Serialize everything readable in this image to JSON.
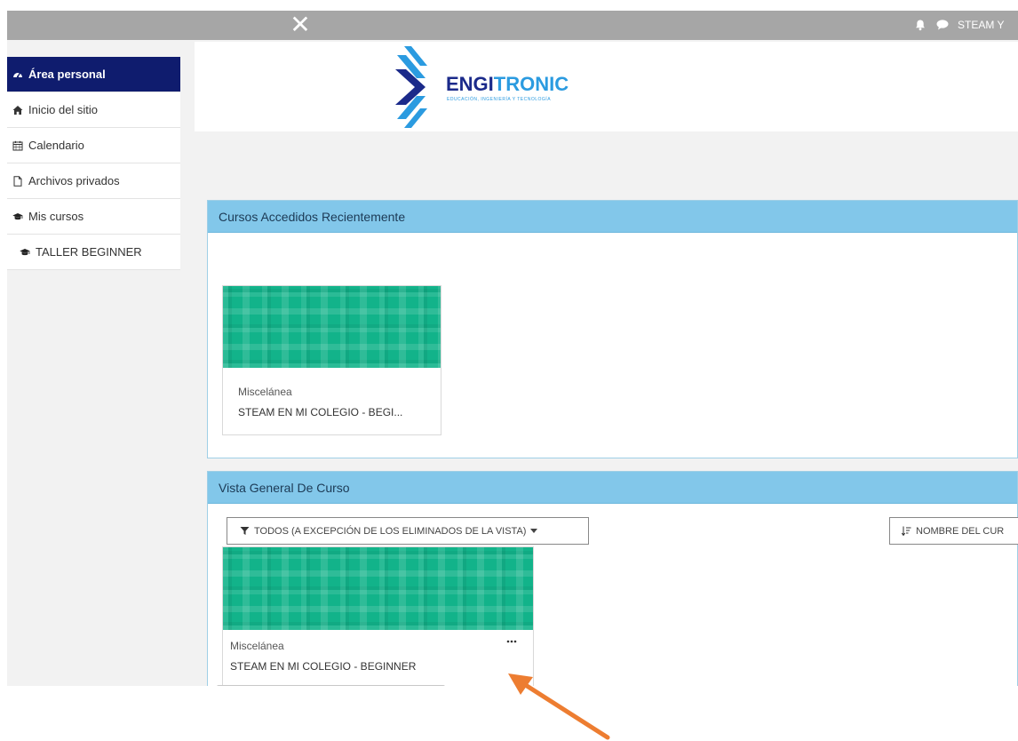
{
  "topbar": {
    "close_icon": "close-icon",
    "close_glyph": "✕",
    "user_name": "STEAM Y"
  },
  "sidebar": {
    "items": [
      {
        "label": "Área personal",
        "icon": "tachometer-icon",
        "active": true
      },
      {
        "label": "Inicio del sitio",
        "icon": "home-icon"
      },
      {
        "label": "Calendario",
        "icon": "calendar-icon"
      },
      {
        "label": "Archivos privados",
        "icon": "file-icon"
      },
      {
        "label": "Mis cursos",
        "icon": "graduation-cap-icon"
      },
      {
        "label": "TALLER BEGINNER",
        "icon": "graduation-cap-icon"
      }
    ]
  },
  "logo": {
    "name_part1": "ENGI",
    "name_part2": "TRONIC",
    "tagline": "EDUCACIÓN, INGENIERÍA Y TECNOLOGÍA",
    "colors": {
      "dark": "#1b2a8a",
      "light": "#2b9be0"
    }
  },
  "recent": {
    "title": "Cursos Accedidos Recientemente",
    "course": {
      "category": "Miscelánea",
      "name": "STEAM EN MI COLEGIO - BEGI..."
    }
  },
  "overview": {
    "title": "Vista General De Curso",
    "filter_label": "TODOS (A EXCEPCIÓN DE LOS ELIMINADOS DE LA VISTA)",
    "sort_label": "NOMBRE DEL CUR",
    "course": {
      "category": "Miscelánea",
      "name": "STEAM EN MI COLEGIO - BEGINNER",
      "menu_glyph": "•••"
    }
  },
  "colors": {
    "topbar": "#a6a6a6",
    "sidebar_active": "#0f1c6e",
    "block_header": "#82c7ea",
    "course_image": "#12b38a",
    "annotation_arrow": "#ed7d31"
  }
}
